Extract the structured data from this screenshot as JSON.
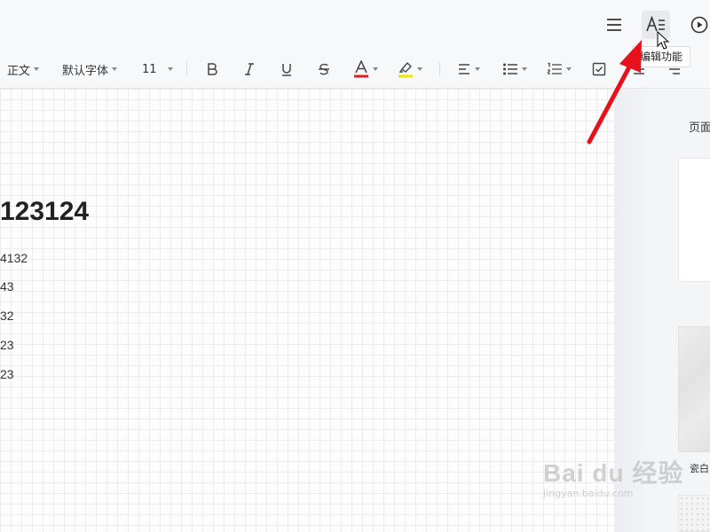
{
  "topbar": {
    "icons": [
      "menu-icon",
      "edit-functions-icon",
      "play-icon"
    ],
    "tooltip": "编辑功能"
  },
  "toolbar": {
    "style": "正文",
    "font": "默认字体",
    "size": "11",
    "icons": [
      "bold-icon",
      "italic-icon",
      "underline-icon",
      "strikethrough-icon",
      "font-color-icon",
      "highlight-icon",
      "align-icon",
      "bullet-list-icon",
      "numbered-list-icon",
      "checkbox-icon",
      "indent-icon",
      "more-icon"
    ],
    "colors": {
      "font_color": "#e02020",
      "highlight": "#f2e600"
    }
  },
  "document": {
    "heading": "123124",
    "lines": [
      "4132",
      "43",
      "32",
      "23",
      "23"
    ]
  },
  "panel": {
    "section_label": "页面",
    "thumb_label": "瓷白"
  },
  "watermark": {
    "main": "Bai du 经验",
    "sub": "jingyan.baidu.com"
  },
  "colors": {
    "arrow": "#e8111b"
  }
}
